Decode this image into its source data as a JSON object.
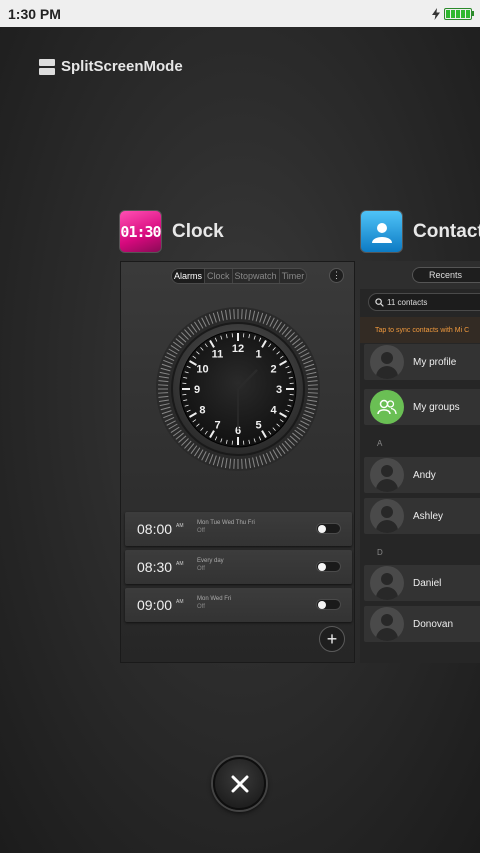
{
  "status_bar": {
    "time": "1:30 PM",
    "battery_cells": 5
  },
  "mode": {
    "label": "SplitScreenMode"
  },
  "apps": {
    "clock": {
      "title": "Clock",
      "icon_text": "01:30",
      "tabs": [
        "Alarms",
        "Clock",
        "Stopwatch",
        "Timer"
      ],
      "active_tab": "Alarms",
      "dial": {
        "numbers": [
          "12",
          "1",
          "2",
          "3",
          "4",
          "5",
          "6",
          "7",
          "8",
          "9",
          "10",
          "11"
        ],
        "hour": 1,
        "minute": 30
      },
      "alarms": [
        {
          "time": "08:00",
          "ampm": "AM",
          "days": "Mon Tue Wed Thu Fri",
          "status": "Off",
          "enabled": false
        },
        {
          "time": "08:30",
          "ampm": "AM",
          "days": "Every day",
          "status": "Off",
          "enabled": false
        },
        {
          "time": "09:00",
          "ampm": "AM",
          "days": "Mon Wed Fri",
          "status": "Off",
          "enabled": false
        }
      ],
      "add_label": "+"
    },
    "contacts": {
      "title": "Contacts",
      "tab": "Recents",
      "search_text": "11 contacts",
      "sync_banner": "Tap to sync contacts with Mi C",
      "rows": [
        {
          "kind": "contact",
          "name": "My profile"
        },
        {
          "kind": "group",
          "name": "My groups"
        },
        {
          "kind": "section",
          "name": "A"
        },
        {
          "kind": "contact",
          "name": "Andy"
        },
        {
          "kind": "contact",
          "name": "Ashley"
        },
        {
          "kind": "section",
          "name": "D"
        },
        {
          "kind": "contact",
          "name": "Daniel"
        },
        {
          "kind": "contact",
          "name": "Donovan"
        }
      ]
    }
  },
  "close": {
    "icon": "close-icon"
  }
}
